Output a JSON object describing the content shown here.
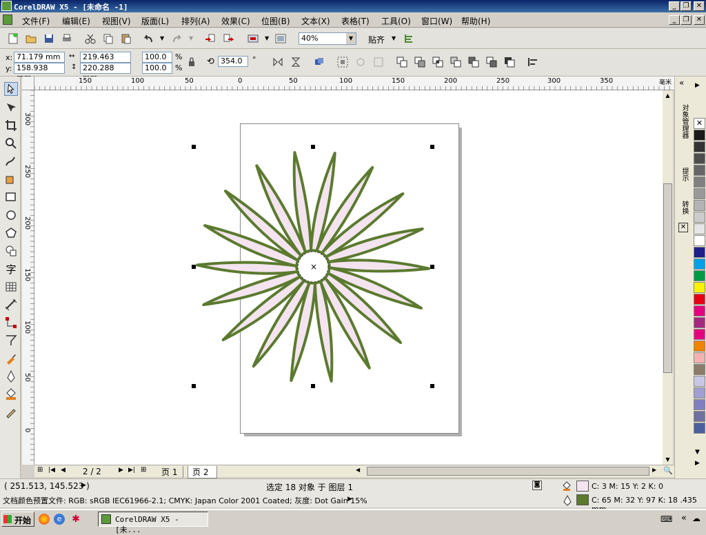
{
  "window": {
    "title": "CorelDRAW X5 - [未命名 -1]"
  },
  "menu": [
    "文件(F)",
    "编辑(E)",
    "视图(V)",
    "版面(L)",
    "排列(A)",
    "效果(C)",
    "位图(B)",
    "文本(X)",
    "表格(T)",
    "工具(O)",
    "窗口(W)",
    "帮助(H)"
  ],
  "toolbar": {
    "zoom": "40%",
    "snap_label": "贴齐"
  },
  "props": {
    "x_label": "x:",
    "x_value": "71.179 mm",
    "y_label": "y:",
    "y_value": "158.938 mm",
    "width_value": "219.463 mm",
    "height_value": "220.288 mm",
    "scale_x": "100.0",
    "scale_y": "100.0",
    "percent": "%",
    "rotation": "354.0",
    "degree": "°"
  },
  "ruler_h": [
    "150",
    "100",
    "50",
    "0",
    "50",
    "100",
    "150",
    "200",
    "250",
    "300",
    "350"
  ],
  "ruler_h_unit": "毫米",
  "ruler_v": [
    "300",
    "250",
    "200",
    "150",
    "100",
    "50",
    "0"
  ],
  "page_nav": {
    "counter": "2 / 2",
    "tabs": [
      "页 1",
      "页 2"
    ]
  },
  "docker_tabs": [
    "对象管理器",
    "提示",
    "转换"
  ],
  "palette_colors": [
    "#ffffff",
    "#1a1a1a",
    "#333333",
    "#4d4d4d",
    "#666666",
    "#808080",
    "#999999",
    "#b3b3b3",
    "#cccccc",
    "#e6e6e6",
    "#ffffff",
    "#1d2088",
    "#00a0e9",
    "#009944",
    "#fff100",
    "#e60012",
    "#e4007f",
    "#a5297f",
    "#e4007f",
    "#f08300",
    "#f5b2b2",
    "#8c7b6b",
    "#c8c8e6",
    "#a0a0d2",
    "#8080c0",
    "#7070a0",
    "#4a5fa0"
  ],
  "status": {
    "coords": "( 251.513, 145.523 )",
    "selection": "选定 18 对象 于 图层 1",
    "fill_text": "C: 3 M: 15 Y: 2 K: 0",
    "outline_text": "C: 65 M: 32 Y: 97 K: 18  .435 mm",
    "profile": "文档颜色预置文件: RGB: sRGB IEC61966-2.1; CMYK: Japan Color 2001 Coated; 灰度: Dot Gain 15%"
  },
  "colors": {
    "fill": "#f4e4ef",
    "outline": "#5b7a2f"
  },
  "taskbar": {
    "start": "开始",
    "task": "CorelDRAW X5 - [未..."
  }
}
